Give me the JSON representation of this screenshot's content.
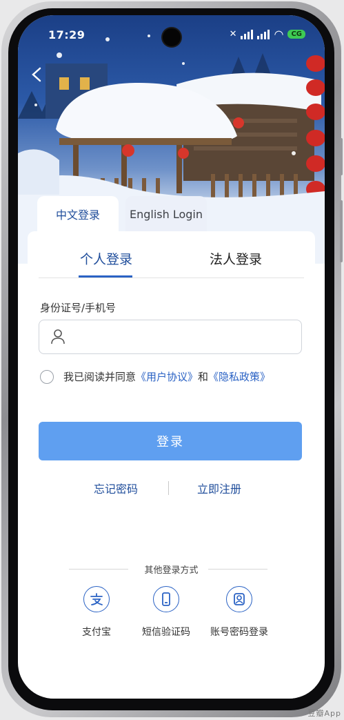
{
  "status_bar": {
    "time": "17:29",
    "battery_label": "CG"
  },
  "language_tabs": {
    "chinese": "中文登录",
    "english": "English Login"
  },
  "login_type_tabs": {
    "personal": "个人登录",
    "legal_entity": "法人登录"
  },
  "form": {
    "field_label": "身份证号/手机号",
    "field_value": "",
    "field_placeholder": ""
  },
  "agreement": {
    "prefix": "我已阅读并同意",
    "user_agreement": "《用户协议》",
    "and": "和",
    "privacy_policy": "《隐私政策》"
  },
  "login_button": "登录",
  "links": {
    "forgot_password": "忘记密码",
    "register": "立即注册"
  },
  "other_methods": {
    "title": "其他登录方式",
    "alipay": "支付宝",
    "sms": "短信验证码",
    "password": "账号密码登录"
  },
  "watermark": "豆瓣App",
  "colors": {
    "primary": "#1f4d9b",
    "accent": "#2a62c4",
    "button": "#5f9ff0"
  }
}
